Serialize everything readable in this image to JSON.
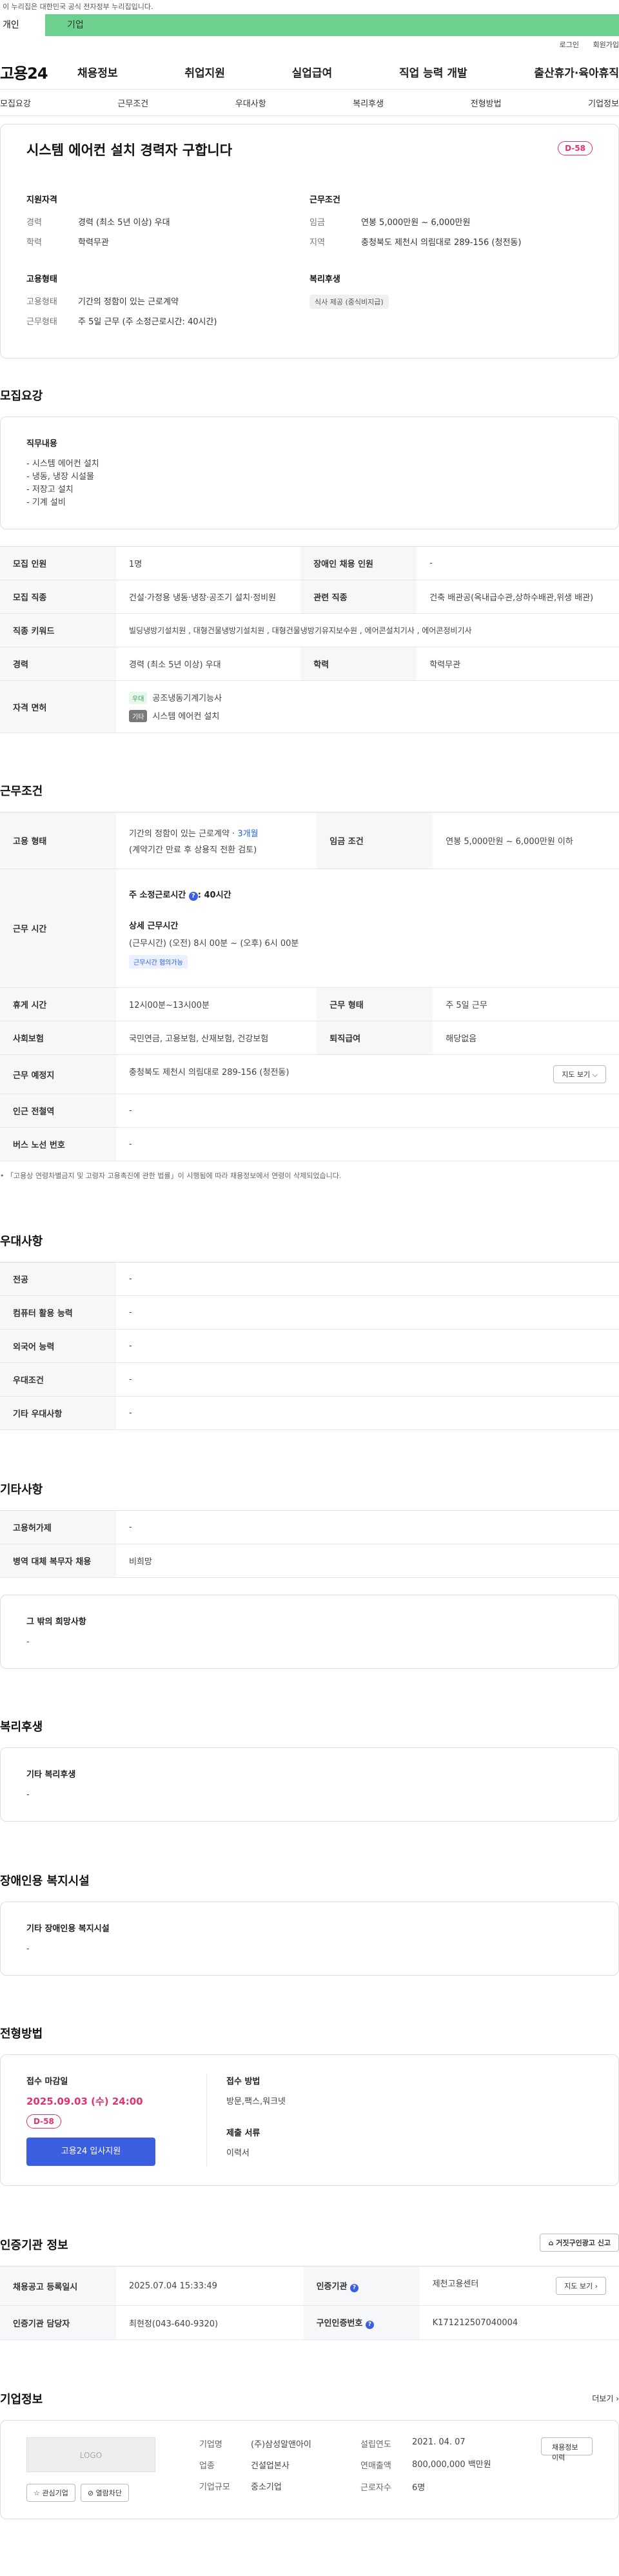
{
  "top": {
    "gov_notice": "이 누리집은 대한민국 공식 전자정부 누리집입니다.",
    "tab_person": "개인",
    "tab_company": "기업",
    "login": "로그인",
    "join": "회원가입"
  },
  "gnb": {
    "logo": "고용24",
    "menu": [
      "채용정보",
      "취업지원",
      "실업급여",
      "직업 능력 개발",
      "출산휴가·육아휴직"
    ]
  },
  "subnav": [
    "모집요강",
    "근무조건",
    "우대사항",
    "복리후생",
    "전형방법",
    "기업정보"
  ],
  "hero": {
    "title": "시스템 에어컨 설치 경력자 구합니다",
    "dday": "D-58",
    "qual_title": "지원자격",
    "qual": [
      {
        "k": "경력",
        "v": "경력 (최소 5년 이상) 우대"
      },
      {
        "k": "학력",
        "v": "학력무관"
      }
    ],
    "cond_title": "근무조건",
    "cond": [
      {
        "k": "임금",
        "v": "연봉 5,000만원 ~ 6,000만원"
      },
      {
        "k": "지역",
        "v": "충청북도 제천시 의림대로 289-156 (청전동)"
      }
    ],
    "emp_title": "고용형태",
    "emp": [
      {
        "k": "고용형태",
        "v": "기간의 정함이 있는 근로계약"
      },
      {
        "k": "근무형태",
        "v": "주 5일 근무 (주 소정근로시간: 40시간)"
      }
    ],
    "welfare_title": "복리후생",
    "welfare_chip": "식사 제공 (중식비지급)"
  },
  "recruit": {
    "title": "모집요강",
    "duty_title": "직무내용",
    "duty_lines": [
      "- 시스템 에어컨 설치",
      "- 냉동, 냉장 시설물",
      "- 저장고 설치",
      "- 기계 설비"
    ],
    "rows": {
      "count_k": "모집 인원",
      "count_v": "1명",
      "disab_k": "장애인 채용 인원",
      "disab_v": "-",
      "job_k": "모집 직종",
      "job_v": "건설·가정용 냉동·냉장·공조기 설치·정비원",
      "rel_k": "관련 직종",
      "rel_v": "건축 배관공(옥내급수관,상하수배관,위생 배관)",
      "kw_k": "직종 키워드",
      "kw_v": "빌딩냉방기설치원 , 대형건물냉방기설치원 , 대형건물냉방기유지보수원 , 에어콘설치기사 , 에어콘정비기사",
      "exp_k": "경력",
      "exp_v": "경력 (최소 5년 이상) 우대",
      "edu_k": "학력",
      "edu_v": "학력무관",
      "lic_k": "자격 면허",
      "lic_tag1": "우대",
      "lic_v1": "공조냉동기계기능사",
      "lic_tag2": "기타",
      "lic_v2": "시스템 에어컨 설치"
    }
  },
  "work": {
    "title": "근무조건",
    "emp_k": "고용 형태",
    "emp_v1": "기간의 정함이 있는 근로계약 · ",
    "emp_v1b": "3개월",
    "emp_v2": "(계약기간 만료 후 상용직 전환 검토)",
    "pay_k": "임금 조건",
    "pay_v": "연봉 5,000만원 ~ 6,000만원 이하",
    "time_k": "근무 시간",
    "time_v1": "주 소정근로시간",
    "time_v1b": ": 40시간",
    "time_detail_title": "상세 근무시간",
    "time_detail": "(근무시간) (오전) 8시 00분 ~ (오후) 6시 00분",
    "time_badge": "근무시간 협의가능",
    "rest_k": "휴게 시간",
    "rest_v": "12시00분~13시00분",
    "form_k": "근무 형태",
    "form_v": "주 5일 근무",
    "ins_k": "사회보험",
    "ins_v": "국민연금, 고용보험, 산재보험, 건강보험",
    "ret_k": "퇴직급여",
    "ret_v": "해당없음",
    "place_k": "근무 예정지",
    "place_v": "충청북도 제천시 의림대로 289-156 (청전동)",
    "map_btn": "지도 보기 ⌵",
    "sub_k": "인근 전철역",
    "sub_v": "-",
    "bus_k": "버스 노선 번호",
    "bus_v": "-",
    "note": "「고용상 연령차별금지 및 고령자 고용촉진에 관한 법률」이 시행됨에 따라 채용정보에서 연령이 삭제되었습니다."
  },
  "pref": {
    "title": "우대사항",
    "rows": [
      {
        "k": "전공",
        "v": "-"
      },
      {
        "k": "컴퓨터 활용 능력",
        "v": "-"
      },
      {
        "k": "외국어 능력",
        "v": "-"
      },
      {
        "k": "우대조건",
        "v": "-"
      },
      {
        "k": "기타 우대사항",
        "v": "-"
      }
    ]
  },
  "etc": {
    "title": "기타사항",
    "rows": [
      {
        "k": "고용허가제",
        "v": "-"
      },
      {
        "k": "병역 대체 복무자 채용",
        "v": "비희망"
      }
    ],
    "other_title": "그 밖의 희망사항",
    "other_v": "-"
  },
  "welfare": {
    "title": "복리후생",
    "box_title": "기타 복리후생",
    "box_v": "-"
  },
  "disab": {
    "title": "장애인용 복지시설",
    "box_title": "기타 장애인용 복지시설",
    "box_v": "-"
  },
  "apply": {
    "title": "전형방법",
    "deadline_title": "접수 마감일",
    "deadline": "2025.09.03 (수) 24:00",
    "dday": "D-58",
    "button": "고용24 입사지원",
    "method_title": "접수 방법",
    "method": "방문,팩스,워크넷",
    "doc_title": "제출 서류",
    "doc": "이력서"
  },
  "cert": {
    "title": "인증기관 정보",
    "report_btn": "거짓구인광고 신고",
    "date_k": "채용공고 등록일시",
    "date_v": "2025.07.04 15:33:49",
    "org_k": "인증기관",
    "org_v": "제천고용센터",
    "map_btn": "지도 보기 ›",
    "mgr_k": "인증기관 담당자",
    "mgr_v": "최현정(043-640-9320)",
    "no_k": "구인인증번호",
    "no_v": "K171212507040004"
  },
  "company": {
    "title": "기업정보",
    "more": "더보기 ›",
    "logo": "LOGO",
    "fav": "☆ 관심기업",
    "block": "⊘ 열람차단",
    "rows_left": [
      {
        "k": "기업명",
        "v": "(주)삼성알앤아이"
      },
      {
        "k": "업종",
        "v": "건설업본사"
      },
      {
        "k": "기업규모",
        "v": "중소기업"
      }
    ],
    "rows_right": [
      {
        "k": "설립연도",
        "v": "2021. 04. 07"
      },
      {
        "k": "연매출액",
        "v": "800,000,000 백만원"
      },
      {
        "k": "근로자수",
        "v": "6명"
      }
    ],
    "view_btn": "채용정보 이력"
  }
}
